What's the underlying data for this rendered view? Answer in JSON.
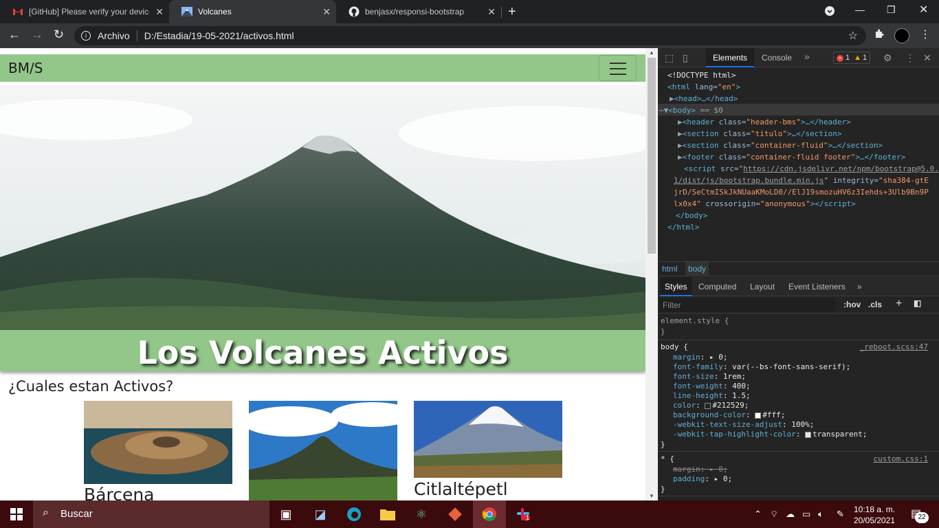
{
  "browser": {
    "tabs": [
      {
        "title": "[GitHub] Please verify your device",
        "icon": "gmail-icon"
      },
      {
        "title": "Volcanes",
        "icon": "mountain-icon"
      },
      {
        "title": "benjasx/responsi-bootstrap",
        "icon": "github-icon"
      }
    ],
    "active_tab": 1,
    "address": {
      "label": "Archivo",
      "url": "D:/Estadia/19-05-2021/activos.html"
    }
  },
  "page": {
    "brand": "BM/S",
    "hero_title": "Los Volcanes Activos",
    "section_heading": "¿Cuales estan Activos?",
    "cards": [
      {
        "title": "Bárcena"
      },
      {
        "title": ""
      },
      {
        "title": "Citlaltépetl"
      }
    ],
    "colors": {
      "navbar": "#93c78a",
      "title_band": "#93c78a"
    }
  },
  "devtools": {
    "tabs": [
      "Elements",
      "Console"
    ],
    "active_tab": "Elements",
    "errors": "1",
    "warnings": "1",
    "dom": {
      "doctype": "<!DOCTYPE html>",
      "html_open_tag": "<html",
      "html_lang_attr": " lang=",
      "html_lang_val": "\"en\"",
      "html_open_close": ">",
      "head": "<head>…</head>",
      "body_open": "<body>",
      "body_marker": " == $0",
      "children": [
        {
          "tag": "header",
          "cls": "\"header-bms\""
        },
        {
          "tag": "section",
          "cls": "\"titulo\""
        },
        {
          "tag": "section",
          "cls": "\"container-fluid\""
        },
        {
          "tag": "footer",
          "cls": "\"container-fluid footer\""
        }
      ],
      "script_src_1": "https://cdn.jsdelivr.net/npm/bootstrap@5.0.",
      "script_src_2": "1/dist/js/bootstrap.bundle.min.js",
      "script_integrity_1": "\"sha384-gtE",
      "script_integrity_2": "jrD/SeCtmISkJkNUaaKMoLD0//ElJ19smozuHV6z3Iehds+3Ulb9Bn9P",
      "script_integrity_3": "lx0x4\"",
      "script_crossorigin": "\"anonymous\"",
      "body_close": "</body>",
      "html_close": "</html>"
    },
    "breadcrumbs": [
      "html",
      "body"
    ],
    "sub_tabs": [
      "Styles",
      "Computed",
      "Layout",
      "Event Listeners"
    ],
    "active_sub_tab": "Styles",
    "filter_placeholder": "Filter",
    "filter_hov": ":hov",
    "filter_cls": ".cls",
    "element_style": "element.style {",
    "body_rule": {
      "selector": "body {",
      "source": "_reboot.scss:47",
      "props": [
        {
          "name": "margin",
          "value": "0;"
        },
        {
          "name": "font-family",
          "value": "var(--bs-font-sans-serif);"
        },
        {
          "name": "font-size",
          "value": "1rem;"
        },
        {
          "name": "font-weight",
          "value": "400;"
        },
        {
          "name": "line-height",
          "value": "1.5;"
        },
        {
          "name": "color",
          "value": "#212529;"
        },
        {
          "name": "background-color",
          "value": "#fff;"
        },
        {
          "name": "-webkit-text-size-adjust",
          "value": "100%;"
        },
        {
          "name": "-webkit-tap-highlight-color",
          "value": "transparent;"
        }
      ],
      "color_swatch": "#212529",
      "bg_swatch": "#ffffff"
    },
    "star_rule": {
      "selector": "* {",
      "source": "custom.css:1",
      "props": [
        {
          "name": "margin",
          "value": "0;"
        },
        {
          "name": "padding",
          "value": "0;"
        }
      ]
    }
  },
  "taskbar": {
    "search": "Buscar",
    "time": "10:18 a. m.",
    "date": "20/05/2021",
    "notifications": "22",
    "slack_badge": "1"
  }
}
